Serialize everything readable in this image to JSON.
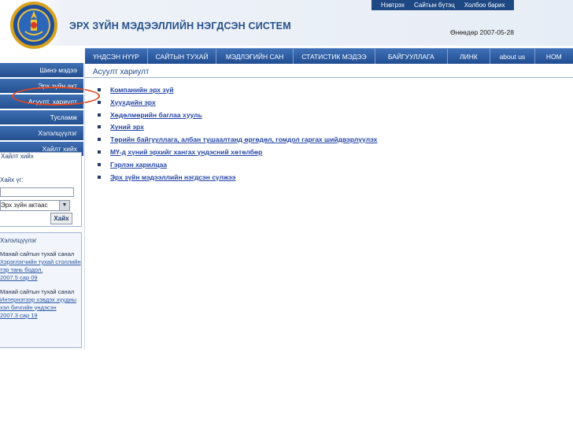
{
  "header": {
    "site_title": "ЭРХ ЗҮЙН МЭДЭЭЛЛИЙН НЭГДСЭН СИСТЕМ",
    "date": "Өнөөдөр 2007-05-28",
    "top_links": [
      "Нэвтрэх",
      "Сайтын бүтэц",
      "Холбоо барих"
    ],
    "colors": {
      "header_blue": "#1d4884",
      "nav_blue": "#2f5fa3",
      "link_blue": "#2647a8",
      "highlight_red": "#e3481f"
    }
  },
  "nav": [
    "ҮНДСЭН НҮҮР",
    "САЙТЫН ТУХАЙ",
    "МЭДЛЭГИЙН САН",
    "СТАТИСТИК МЭДЭЭ",
    "БАЙГУУЛЛАГА",
    "ЛИНК",
    "about us",
    "НОМ"
  ],
  "sidebar": {
    "items": [
      "Шинэ мэдээ",
      "Эрх зүйн акт",
      "Асуулт, хариулт",
      "Тусламж",
      "Хэлэлцүүлэг",
      "Хайлт хийх"
    ]
  },
  "search": {
    "heading": "Хайлт хийх",
    "label": "Хайх үг:",
    "select_value": "Эрх зүйн актаас",
    "button": "Хайх"
  },
  "feedback": {
    "heading": "Хэлэлцүүлэг",
    "entries": [
      {
        "title": "Манай сайтын тухай санал",
        "link": "Хэрэглэгчийн тухай столлийн тэр тань бодол.",
        "date": "2007.5 сар 09"
      },
      {
        "title": "Манай сайтын тухай санал",
        "link": "Интернэтээр хэвдэх хүүдны хэл бичгийн үндэсэн",
        "date": "2007.3 сар 19"
      }
    ]
  },
  "content": {
    "title": "Асуулт хариулт",
    "links": [
      "Компанийн эрх зүй",
      "Хүүхдийн эрх",
      "Хөдөлмөрийн баглаа хууль",
      "Хүний эрх",
      "Төрийн байгууллага, албан тушаалтанд өргөдөл, гомдол гаргах шийдвэрлүүлэх",
      "МҮ-д хүний эрхийг хангах үндэсний хөтөлбөр",
      "Гэрлэн харилцаа",
      "Эрх зүйн мэдээллийн нэгдсэн сүлжээ"
    ]
  }
}
